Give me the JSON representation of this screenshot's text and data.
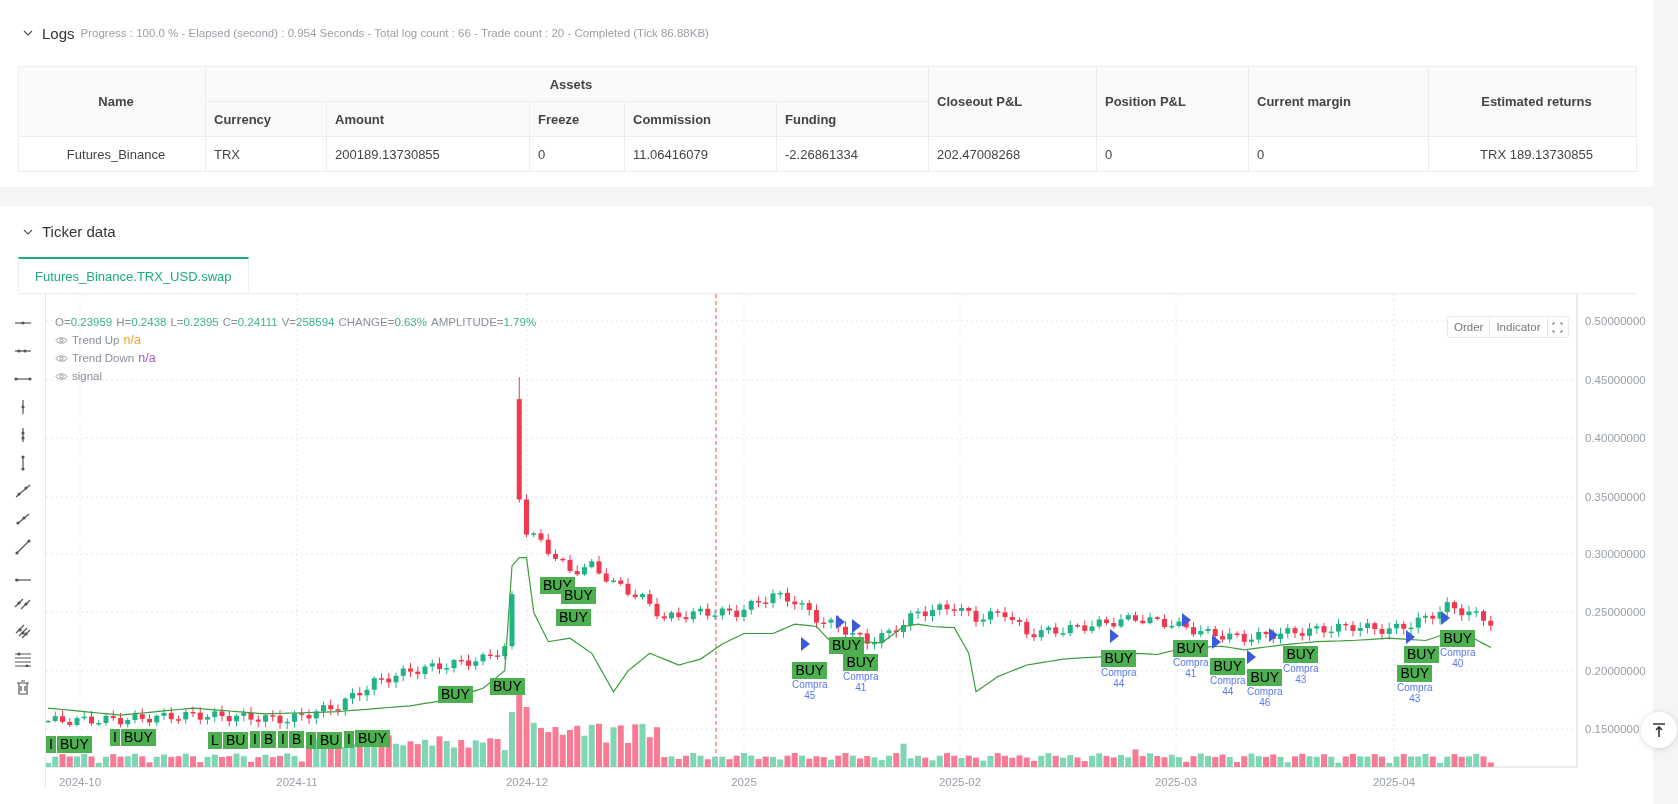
{
  "logs": {
    "title": "Logs",
    "expanded": true,
    "summary": "Progress : 100.0 % - Elapsed (second) : 0.954  Seconds - Total log count : 66 - Trade count : 20 - Completed (Tick 86.88KB)"
  },
  "table": {
    "group_header": "Assets",
    "columns": [
      "Name",
      "Currency",
      "Amount",
      "Freeze",
      "Commission",
      "Funding",
      "Closeout P&L",
      "Position P&L",
      "Current margin",
      "Estimated returns"
    ],
    "rows": [
      [
        "Futures_Binance",
        "TRX",
        "200189.13730855",
        "0",
        "11.06416079",
        "-2.26861334",
        "202.47008268",
        "0",
        "0",
        "TRX 189.13730855"
      ]
    ]
  },
  "ticker": {
    "title": "Ticker data",
    "expanded": true,
    "tabs": [
      {
        "label": "Futures_Binance.TRX_USD.swap",
        "selected": true
      }
    ]
  },
  "chart": {
    "ohlc": [
      {
        "label": "O=",
        "value": "0.23959"
      },
      {
        "label": "H=",
        "value": "0.2438"
      },
      {
        "label": "L=",
        "value": "0.2395"
      },
      {
        "label": "C=",
        "value": "0.24111"
      },
      {
        "label": "V=",
        "value": "258594"
      },
      {
        "label": "CHANGE=",
        "value": "0.63%"
      },
      {
        "label": "AMPLITUDE=",
        "value": "1.79%"
      }
    ],
    "legend": [
      {
        "name": "Trend Up",
        "value": "n/a",
        "color": "#f5a623"
      },
      {
        "name": "Trend Down",
        "value": "n/a",
        "color": "#9b59d0"
      },
      {
        "name": "signal"
      }
    ],
    "buttons": [
      "Order",
      "Indicator"
    ],
    "yticks": [
      "0.50000000",
      "0.45000000",
      "0.40000000",
      "0.35000000",
      "0.30000000",
      "0.25000000",
      "0.20000000",
      "0.1500000"
    ],
    "xticks": [
      "2024-10",
      "2024-11",
      "2024-12",
      "2025",
      "2025-02",
      "2025-03",
      "2025-04"
    ],
    "markers": [
      {
        "text": "I"
      },
      {
        "text": "BUY"
      },
      {
        "text": "I"
      },
      {
        "text": "BUY"
      },
      {
        "text": "L"
      },
      {
        "text": "BU"
      },
      {
        "text": "I"
      },
      {
        "text": "B"
      },
      {
        "text": "I"
      },
      {
        "text": "B"
      },
      {
        "text": "I"
      },
      {
        "text": "BU"
      },
      {
        "text": "I"
      },
      {
        "text": "BUY"
      },
      {
        "text": "BUY"
      },
      {
        "text": "BUY"
      },
      {
        "text": "BUY"
      },
      {
        "text": "BUY"
      },
      {
        "text": "BUY"
      },
      {
        "text": "BUY",
        "note": "Compra",
        "count": "45"
      },
      {
        "text": "BUY"
      },
      {
        "text": "BUY",
        "note": "Compra",
        "count": "41"
      },
      {
        "text": "BUY",
        "note": "Compra",
        "count": "44"
      },
      {
        "text": "BUY",
        "note": "Compra",
        "count": "41"
      },
      {
        "text": "BUY",
        "note": "Compra",
        "count": "44"
      },
      {
        "text": "BUY",
        "note": "Compra",
        "count": "46"
      },
      {
        "text": "BUY",
        "note": "Compra",
        "count": "43"
      },
      {
        "text": "BUY"
      },
      {
        "text": "BUY",
        "note": "Compra",
        "count": "43"
      },
      {
        "text": "BUY",
        "note": "Compra",
        "count": "40"
      }
    ]
  }
}
